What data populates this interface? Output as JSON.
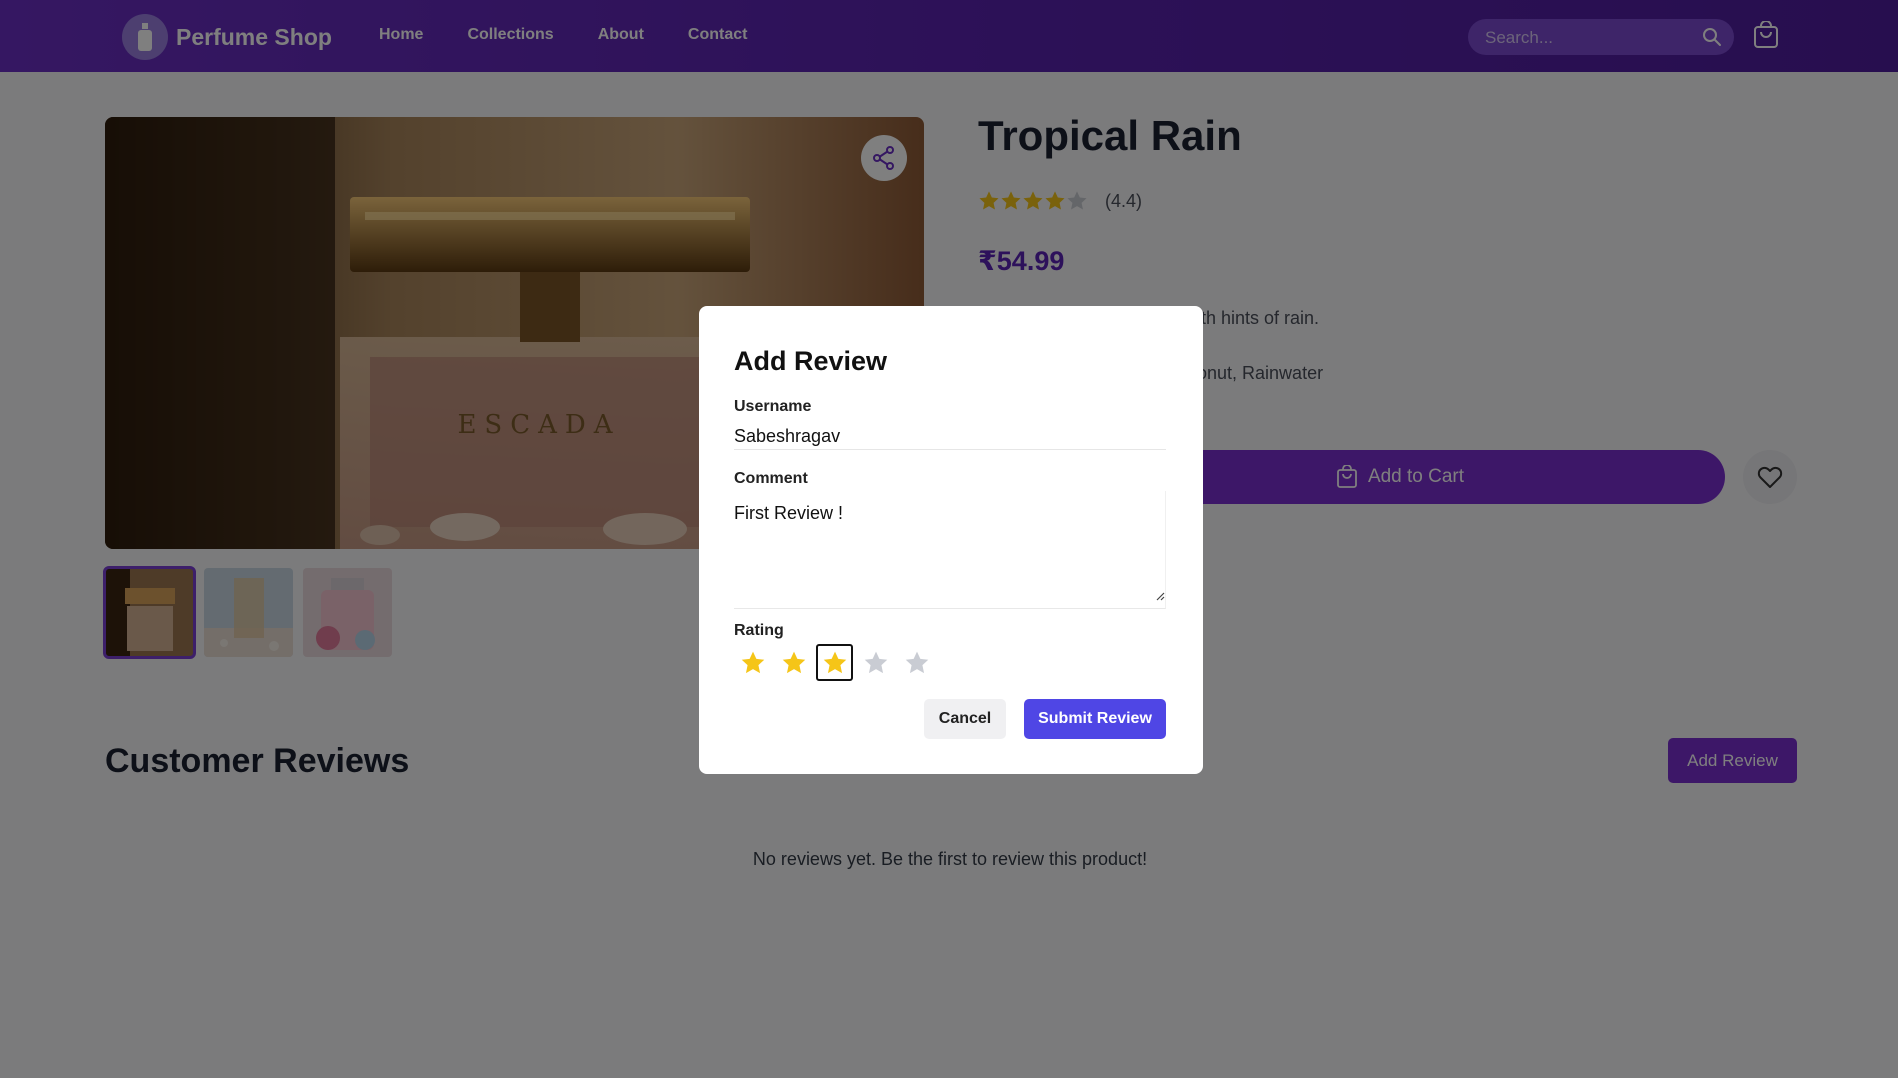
{
  "nav": {
    "brand": "Perfume Shop",
    "links": [
      "Home",
      "Collections",
      "About",
      "Contact"
    ],
    "search_placeholder": "Search..."
  },
  "product": {
    "title": "Tropical Rain",
    "rating": 4.4,
    "rating_text": "(4.4)",
    "price": "₹54.99",
    "description_visible": "ith hints of rain.",
    "notes_visible": "onut, Rainwater",
    "add_to_cart": "Add to Cart",
    "image_brand_text": "ESCADA",
    "thumbnail_count": 3,
    "active_thumbnail": 1
  },
  "reviews": {
    "heading": "Customer Reviews",
    "add_button": "Add Review",
    "empty_text": "No reviews yet. Be the first to review this product!"
  },
  "modal": {
    "title": "Add Review",
    "username_label": "Username",
    "username_value": "Sabeshragav",
    "comment_label": "Comment",
    "comment_value": "First Review !",
    "rating_label": "Rating",
    "rating_selected": 3,
    "rating_max": 5,
    "cancel": "Cancel",
    "submit": "Submit Review"
  },
  "colors": {
    "primary": "#7b2fd1",
    "submit": "#4f46e5",
    "star_filled": "#f5c518",
    "star_empty": "#c9ccd3"
  }
}
